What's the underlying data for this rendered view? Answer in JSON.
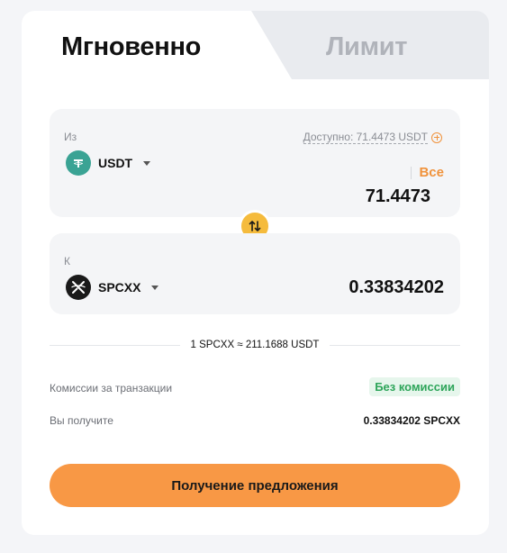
{
  "tabs": {
    "instant": "Мгновенно",
    "limit": "Лимит"
  },
  "from": {
    "label": "Из",
    "available": "Доступно: 71.4473 USDT",
    "asset": "USDT",
    "max_label": "Все",
    "amount": "71.4473"
  },
  "to": {
    "label": "К",
    "asset": "SPCXX",
    "amount": "0.33834202"
  },
  "rate": "1 SPCXX ≈ 211.1688 USDT",
  "fees": {
    "label": "Комиссии за транзакции",
    "value": "Без комиссии"
  },
  "receive": {
    "label": "Вы получите",
    "value": "0.33834202 SPCXX"
  },
  "cta_label": "Получение предложения",
  "colors": {
    "accent": "#f89845",
    "swap": "#f5bb3c",
    "fee_badge_bg": "#e6f6ec",
    "fee_badge_text": "#2ea55a",
    "usdt": "#3aa394"
  },
  "icons": {
    "usdt": "usdt-coin-icon",
    "spcxx": "spcxx-coin-icon",
    "swap": "swap-arrows-icon",
    "plus": "plus-circle-icon"
  }
}
